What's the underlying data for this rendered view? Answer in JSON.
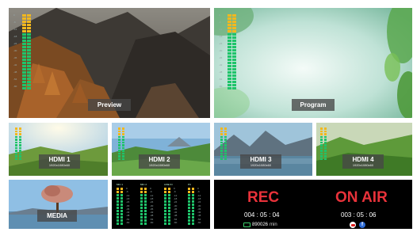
{
  "preview": {
    "label": "Preview"
  },
  "program": {
    "label": "Program"
  },
  "inputs": [
    {
      "name": "HDMI 1",
      "format": "1920x1080x60"
    },
    {
      "name": "HDMI 2",
      "format": "1920x1080x60"
    },
    {
      "name": "HDMI 3",
      "format": "1920x1080x60"
    },
    {
      "name": "HDMI 4",
      "format": "1920x1080x60"
    }
  ],
  "media": {
    "label": "MEDIA"
  },
  "audio_meters": {
    "channels": [
      "MIC 1",
      "MIC 2",
      "LINE IN",
      "PC"
    ]
  },
  "vu_scale": [
    "0",
    "-6",
    "-12",
    "-18",
    "-24",
    "-30",
    "-36",
    "-42",
    "-48",
    "-54",
    "-60"
  ],
  "record": {
    "status": "REC",
    "time": "004 : 05 : 04",
    "storage_value": "890026",
    "storage_unit": "min",
    "storage_icon": "storage-icon"
  },
  "stream": {
    "status": "ON AIR",
    "time": "003 : 05 : 06",
    "platform_icons": [
      "youtube-icon",
      "facebook-icon"
    ]
  },
  "colors": {
    "rec_red": "#e8323a",
    "vu_green": "#1fc46a",
    "vu_yellow": "#f2b81e",
    "label_bg": "#464646"
  }
}
